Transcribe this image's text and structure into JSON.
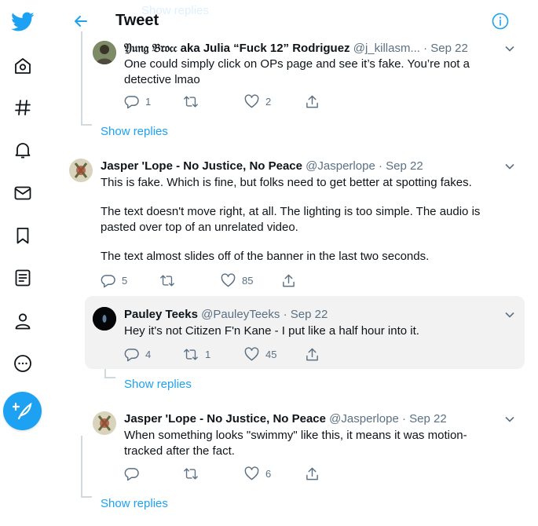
{
  "header": {
    "title": "Tweet",
    "faded_text": "Show replies"
  },
  "nav": {
    "items": [
      "twitter-logo",
      "home",
      "explore",
      "notifications",
      "messages",
      "bookmarks",
      "lists",
      "profile",
      "more"
    ],
    "compose_icon": "feather-plus-icon"
  },
  "tweets": [
    {
      "name": "𝔜𝔲𝔫𝔤 𝔅𝔯𝔬𝔠𝔠 aka Julia “Fuck 12” Rodriguez",
      "handle": "@j_killasm...",
      "date": "· Sep 22",
      "lines": [
        "One could simply click on OPs page and see it’s fake. You’re not a",
        "detective lmao"
      ],
      "replies": "1",
      "retweets": "",
      "likes": "2",
      "show_replies": "Show replies"
    },
    {
      "name": "Jasper 'Lope - No Justice, No Peace",
      "handle": "@Jasperlope",
      "date": "· Sep 22",
      "lines": [
        "This is fake. Which is fine, but folks need to get better at spotting fakes.",
        "",
        "The text doesn't move right, at all. The lighting is too simple. The audio is",
        "pasted over top of an unrelated video.",
        "",
        "The text almost slides off of the banner in the last two seconds."
      ],
      "replies": "5",
      "retweets": "",
      "likes": "85"
    },
    {
      "name": "Pauley Teeks",
      "handle": "@PauleyTeeks",
      "date": "· Sep 22",
      "lines": [
        "Hey it's not Citizen F'n Kane - I put like a half hour into it."
      ],
      "replies": "4",
      "retweets": "1",
      "likes": "45",
      "show_replies": "Show replies"
    },
    {
      "name": "Jasper 'Lope - No Justice, No Peace",
      "handle": "@Jasperlope",
      "date": "· Sep 22",
      "lines": [
        "When something looks \"swimmy\" like this, it means it was motion-",
        "tracked after the fact."
      ],
      "replies": "",
      "retweets": "",
      "likes": "6",
      "show_replies": "Show replies"
    }
  ],
  "colors": {
    "accent": "#1da1f2",
    "secondary_text": "#5b7083",
    "highlight_bg": "#f2f2f2"
  }
}
